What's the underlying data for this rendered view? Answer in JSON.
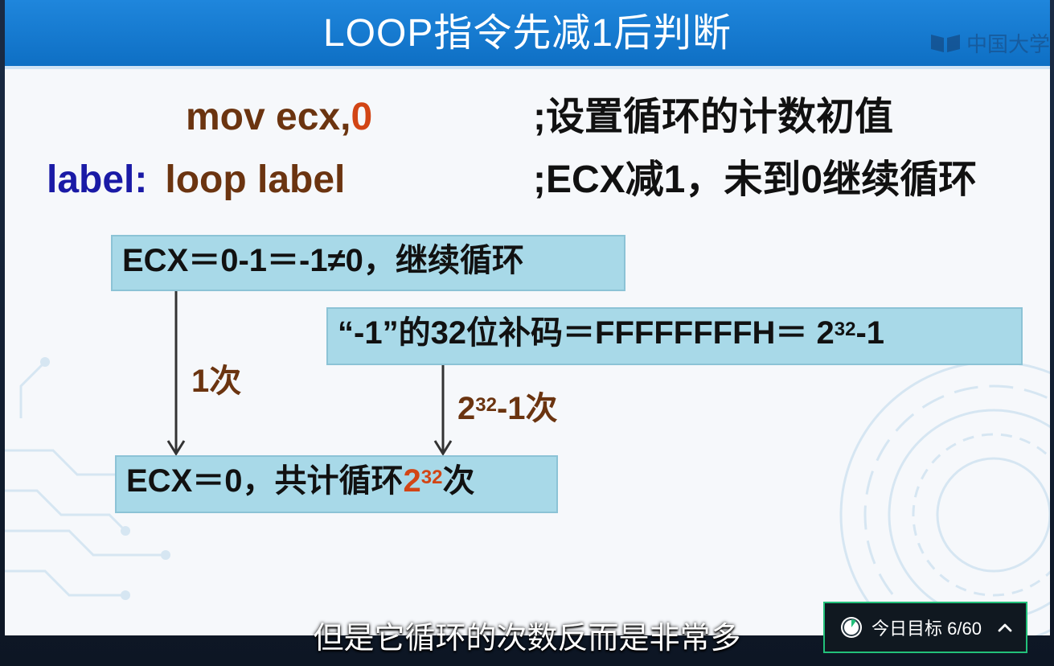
{
  "slide": {
    "title": "LOOP指令先减1后判断",
    "watermark": "中国大学"
  },
  "code": {
    "line1": {
      "instr": "mov ecx,",
      "operand": "0",
      "comment": ";设置循环的计数初值"
    },
    "line2": {
      "label": "label:",
      "instr": "loop label",
      "comment": ";ECX减1，未到0继续循环"
    }
  },
  "diagram": {
    "box_top": "ECX＝0-1＝-1≠0，继续循环",
    "box_mid_prefix": "“-1”的32位补码＝FFFFFFFFH＝ 2",
    "box_mid_exp": "32",
    "box_mid_suffix": "-1",
    "label_left": "1次",
    "label_right_base": "2",
    "label_right_exp": "32",
    "label_right_suffix": "-1次",
    "box_bottom_prefix": "ECX＝0，共计循环",
    "box_bottom_base": "2",
    "box_bottom_exp": "32",
    "box_bottom_suffix": "次"
  },
  "player": {
    "subtitle": "但是它循环的次数反而是非常多",
    "goal_label": "今日目标 6/60",
    "goal_icon": "progress-pie-icon",
    "goal_progress": 0.1,
    "toggle_icon": "chevron-up-icon"
  },
  "colors": {
    "title_bar": "#1f86dc",
    "box_fill": "#a8d9e8",
    "code_brown": "#6b3410",
    "code_orange": "#d24515",
    "label_blue": "#1a1aa6",
    "goal_border": "#22c07a"
  }
}
